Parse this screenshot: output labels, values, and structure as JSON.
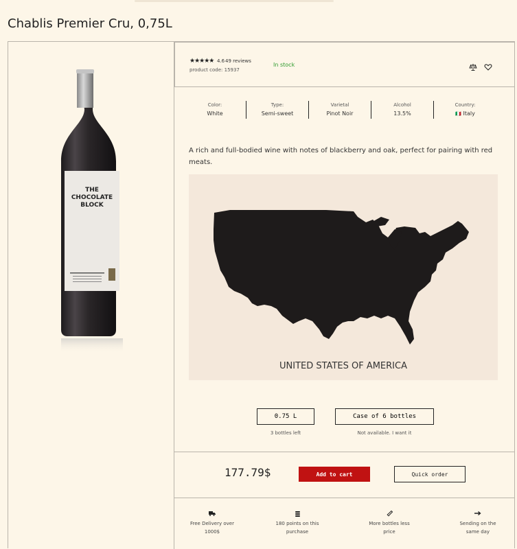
{
  "product": {
    "title": "Chablis Premier Cru, 0,75L",
    "rating": "4.6",
    "reviews": "49 reviews",
    "product_code": "product code: 15937",
    "stock_status": "In stock",
    "stars_count": 5,
    "description": "A rich and full-bodied wine with notes of blackberry and oak, perfect for pairing with red meats."
  },
  "bottle_label": {
    "line1": "THE",
    "line2": "CHOCOLATE",
    "line3": "BLOCK"
  },
  "attributes": [
    {
      "key": "Color:",
      "value": "White"
    },
    {
      "key": "Type:",
      "value": "Semi-sweet"
    },
    {
      "key": "Varietal",
      "value": "Pinot Noir"
    },
    {
      "key": "Alcohol",
      "value": "13.5%"
    },
    {
      "key": "Country:",
      "value": "Italy",
      "flag": "🇮🇹"
    }
  ],
  "map": {
    "label": "UNITED STATES OF AMERICA"
  },
  "options": [
    {
      "label": "0.75 L",
      "note": "3 bottles left"
    },
    {
      "label": "Case of 6 bottles",
      "note": "Not available. I want it"
    }
  ],
  "purchase": {
    "price": "177.79$",
    "add_to_cart": "Add to cart",
    "quick_order": "Quick order"
  },
  "features": [
    {
      "icon": "truck-icon",
      "text_line1": "Free Delivery over",
      "text_line2": "1000$"
    },
    {
      "icon": "coins-icon",
      "text_line1": "180 points on this",
      "text_line2": "purchase"
    },
    {
      "icon": "bottle-icon",
      "text_line1": "More bottles less",
      "text_line2": "price"
    },
    {
      "icon": "arrow-right-icon",
      "text_line1": "Sending on the",
      "text_line2": "same day"
    }
  ],
  "colors": {
    "background": "#fdf6e8",
    "accent_red": "#c01212",
    "in_stock_green": "#2c9a2c",
    "map_background": "#f4e8db",
    "map_fill": "#1e1b1b"
  }
}
